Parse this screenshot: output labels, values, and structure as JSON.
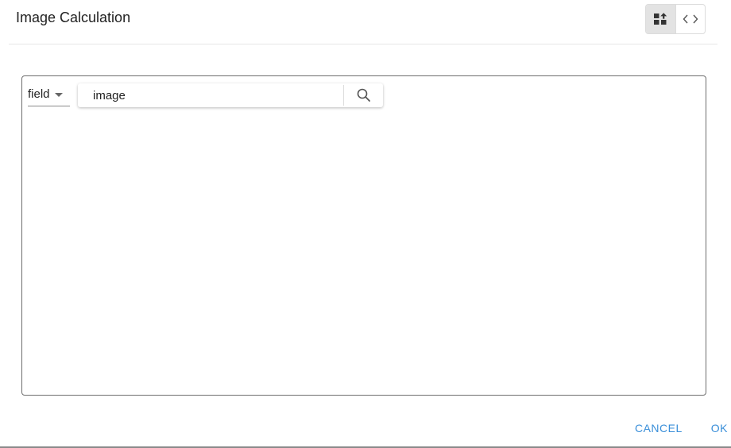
{
  "dialog": {
    "title": "Image Calculation"
  },
  "view_toggle": {
    "options": [
      {
        "icon": "blocks-icon",
        "active": true
      },
      {
        "icon": "code-icon",
        "active": false
      }
    ]
  },
  "editor": {
    "field_select": {
      "selected": "field"
    },
    "search": {
      "value": "image",
      "icon": "search-icon"
    }
  },
  "actions": {
    "cancel_label": "CANCEL",
    "ok_label": "OK"
  },
  "colors": {
    "accent": "#3a8fd9",
    "toggle_active_bg": "#e3e3e3",
    "border": "#6d6d6d"
  }
}
